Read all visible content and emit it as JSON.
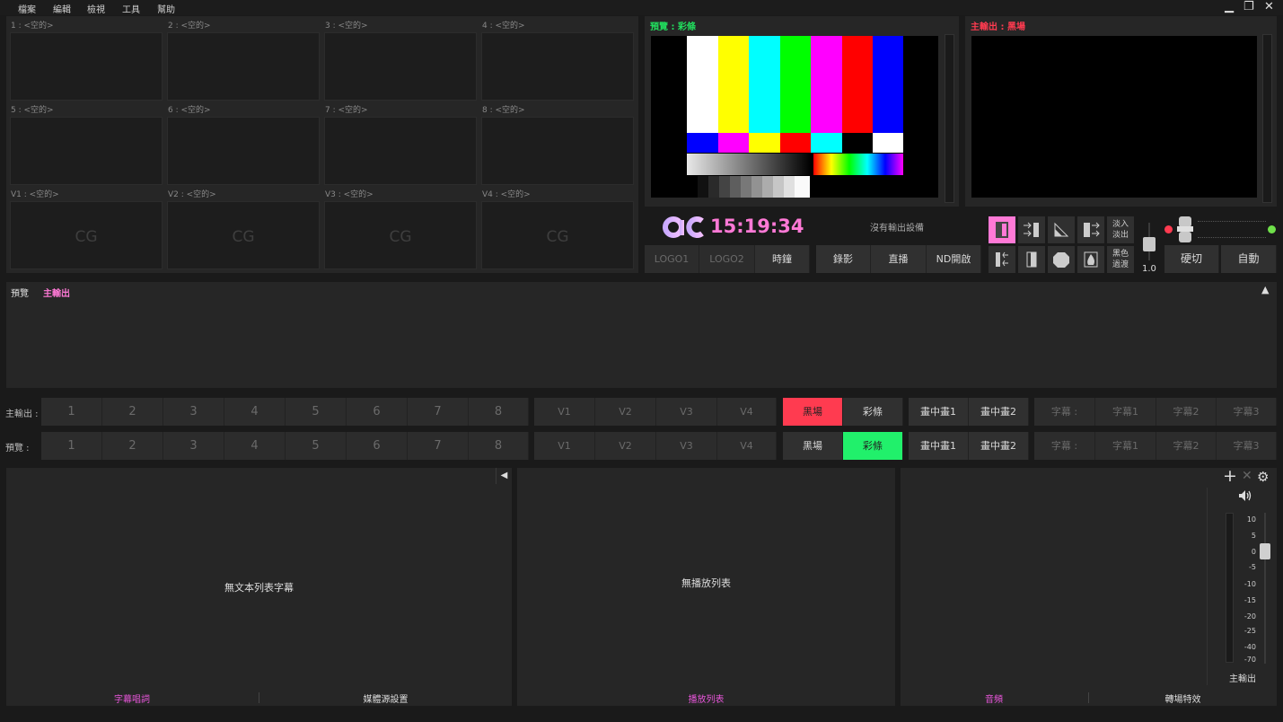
{
  "menu": [
    "檔案",
    "編輯",
    "檢視",
    "工具",
    "幫助"
  ],
  "window_controls": {
    "minimize": "▁",
    "restore": "❐",
    "close": "✕"
  },
  "sources": [
    {
      "label": "1 : <空的>",
      "cg": ""
    },
    {
      "label": "2 : <空的>",
      "cg": ""
    },
    {
      "label": "3 : <空的>",
      "cg": ""
    },
    {
      "label": "4 : <空的>",
      "cg": ""
    },
    {
      "label": "5 : <空的>",
      "cg": ""
    },
    {
      "label": "6 : <空的>",
      "cg": ""
    },
    {
      "label": "7 : <空的>",
      "cg": ""
    },
    {
      "label": "8 : <空的>",
      "cg": ""
    },
    {
      "label": "V1 : <空的>",
      "cg": "CG"
    },
    {
      "label": "V2 : <空的>",
      "cg": "CG"
    },
    {
      "label": "V3 : <空的>",
      "cg": "CG"
    },
    {
      "label": "V4 : <空的>",
      "cg": "CG"
    }
  ],
  "preview": {
    "title": "預覽 : 彩條",
    "color": "#21e05e"
  },
  "program": {
    "title": "主輸出 : 黑場",
    "color": "#ff3b50"
  },
  "clock": {
    "logo": "ac",
    "time": "15:19:34",
    "time_color": "#ff79d6"
  },
  "output_status": "沒有輸出設備",
  "overlay_buttons": [
    "LOGO1",
    "LOGO2",
    "時鐘"
  ],
  "stream_buttons": [
    "錄影",
    "直播",
    "ND開啟"
  ],
  "transition": {
    "fade_label": "淡入\n淡出",
    "black_label": "黑色\n過渡",
    "duration": "1.0",
    "cut_label": "硬切",
    "auto_label": "自動"
  },
  "log_panel": {
    "tab_preview": "預覽",
    "tab_program": "主輸出",
    "collapse": "▲"
  },
  "program_row": {
    "label": "主輸出 :",
    "numbers": [
      "1",
      "2",
      "3",
      "4",
      "5",
      "6",
      "7",
      "8"
    ],
    "virtual": [
      "V1",
      "V2",
      "V3",
      "V4"
    ],
    "black": "黑場",
    "bars": "彩條",
    "pip": [
      "畫中畫1",
      "畫中畫2"
    ],
    "subtitles": [
      "字幕 :",
      "字幕1",
      "字幕2",
      "字幕3"
    ]
  },
  "preview_row": {
    "label": "預覽 :",
    "numbers": [
      "1",
      "2",
      "3",
      "4",
      "5",
      "6",
      "7",
      "8"
    ],
    "virtual": [
      "V1",
      "V2",
      "V3",
      "V4"
    ],
    "black": "黑場",
    "bars": "彩條",
    "pip": [
      "畫中畫1",
      "畫中畫2"
    ],
    "subtitles": [
      "字幕 :",
      "字幕1",
      "字幕2",
      "字幕3"
    ]
  },
  "subtitle_panel": {
    "empty": "無文本列表字幕",
    "tab_active": "字幕唱詞",
    "tab_other": "媒體源設置",
    "toggle": "◀"
  },
  "playlist_panel": {
    "empty": "無播放列表",
    "tab": "播放列表"
  },
  "audio_panel": {
    "tab_active": "音頻",
    "tab_other": "轉場特效",
    "add": "+",
    "remove": "✕",
    "settings": "⚙",
    "speaker": "🔊",
    "scale": [
      "10",
      "5",
      "0",
      "-5",
      "-10",
      "-15",
      "-20",
      "-25",
      "-40",
      "-70"
    ],
    "master_label": "主輸出"
  }
}
